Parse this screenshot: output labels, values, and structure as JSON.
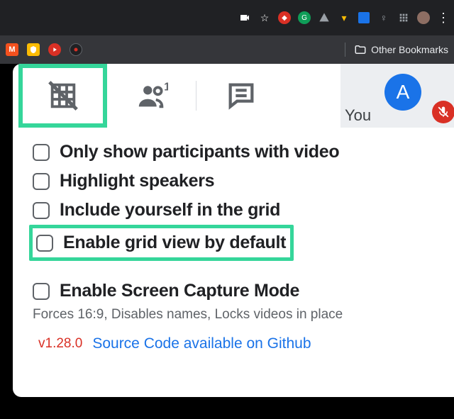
{
  "chrome": {
    "bookmarks_label": "Other Bookmarks"
  },
  "panel": {
    "you_label": "You",
    "avatar_initial": "A",
    "options": [
      {
        "label": "Only show participants with video"
      },
      {
        "label": "Highlight speakers"
      },
      {
        "label": "Include yourself in the grid"
      },
      {
        "label": "Enable grid view by default"
      }
    ],
    "screen_capture": {
      "label": "Enable Screen Capture Mode",
      "desc": "Forces 16:9, Disables names, Locks videos in place"
    },
    "version": "v1.28.0",
    "source_link": "Source Code available on Github"
  }
}
